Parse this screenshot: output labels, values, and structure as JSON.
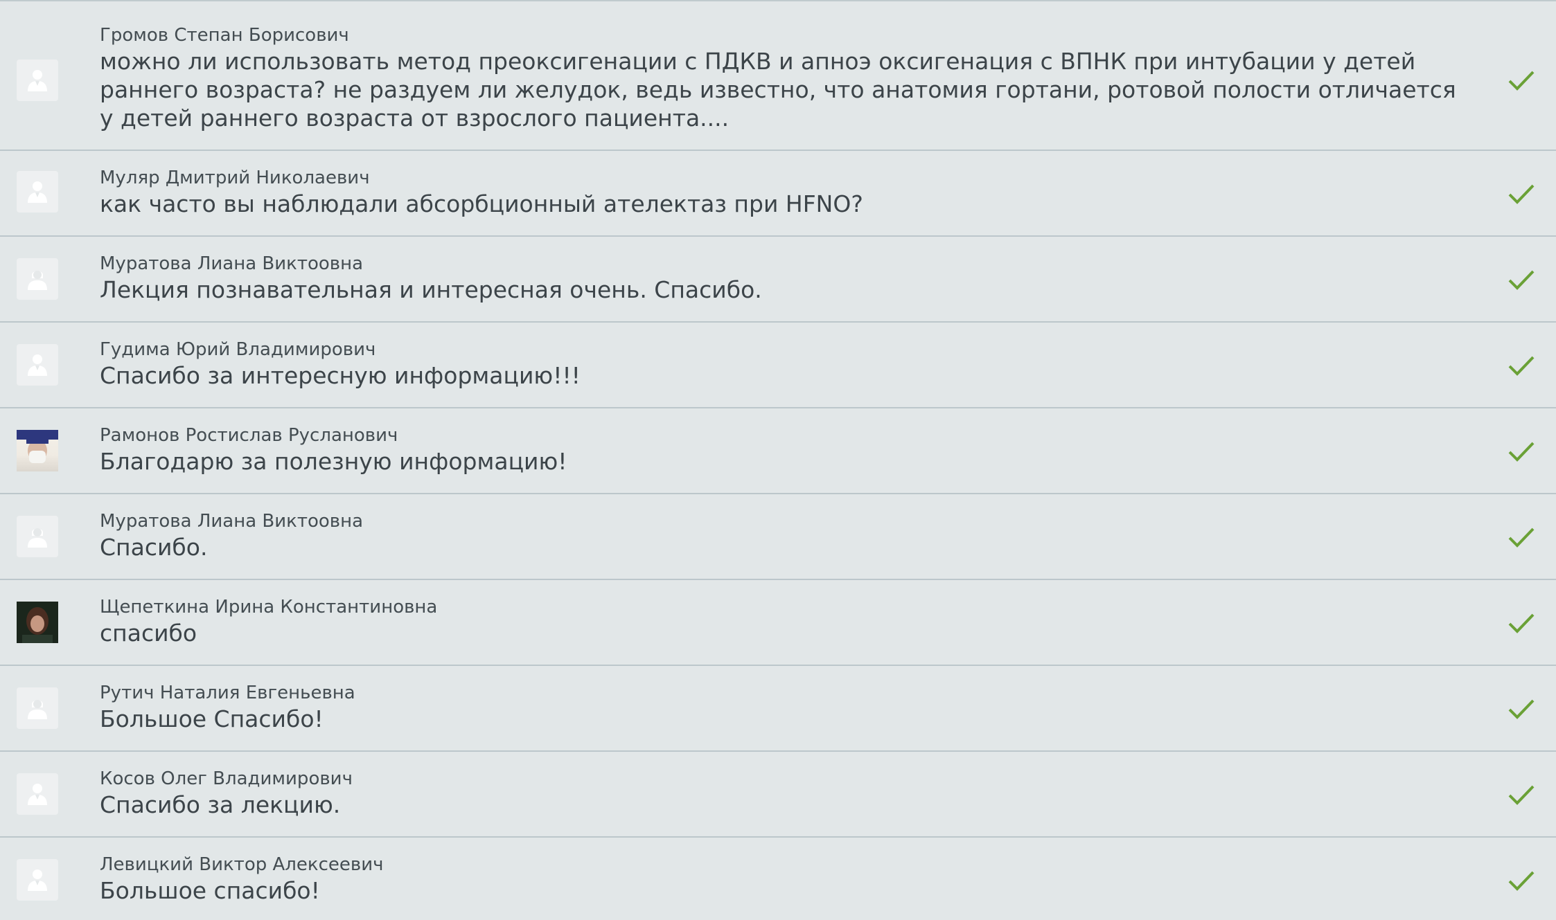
{
  "comments": [
    {
      "author": "Громов Степан Борисович",
      "message": "можно ли использовать метод преоксигенации с ПДКВ и апноэ оксигенация с ВПНК при интубации у детей раннего возраста? не раздуем ли желудок, ведь известно, что анатомия гортани, ротовой полости отличается у детей раннего возраста от взрослого пациента....",
      "avatar": "male-placeholder-icon",
      "status": "approved-check-icon"
    },
    {
      "author": "Муляр Дмитрий Николаевич",
      "message": "как часто вы наблюдали абсорбционный ателектаз при HFNO?",
      "avatar": "male-placeholder-icon",
      "status": "approved-check-icon"
    },
    {
      "author": "Муратова Лиана Виктоовна",
      "message": "Лекция познавательная и интересная очень. Спасибо.",
      "avatar": "female-placeholder-icon",
      "status": "approved-check-icon"
    },
    {
      "author": "Гудима Юрий Владимирович",
      "message": "Спасибо за интересную информацию!!!",
      "avatar": "male-placeholder-icon",
      "status": "approved-check-icon"
    },
    {
      "author": "Рамонов Ростислав Русланович",
      "message": "Благодарю за полезную информацию!",
      "avatar": "photo",
      "status": "approved-check-icon"
    },
    {
      "author": "Муратова Лиана Виктоовна",
      "message": "Спасибо.",
      "avatar": "female-placeholder-icon",
      "status": "approved-check-icon"
    },
    {
      "author": "Щепеткина Ирина Константиновна",
      "message": "спасибо",
      "avatar": "photo",
      "status": "approved-check-icon"
    },
    {
      "author": "Рутич Наталия Евгеньевна",
      "message": "Большое Спасибо!",
      "avatar": "female-placeholder-icon",
      "status": "approved-check-icon"
    },
    {
      "author": "Косов Олег Владимирович",
      "message": "Спасибо за лекцию.",
      "avatar": "male-placeholder-icon",
      "status": "approved-check-icon"
    },
    {
      "author": "Левицкий Виктор Алексеевич",
      "message": "Большое спасибо!",
      "avatar": "male-placeholder-icon",
      "status": "approved-check-icon"
    }
  ],
  "colors": {
    "background": "#e2e7e8",
    "divider": "#bcc7cb",
    "check": "#6aa136",
    "text": "#3c4449"
  }
}
